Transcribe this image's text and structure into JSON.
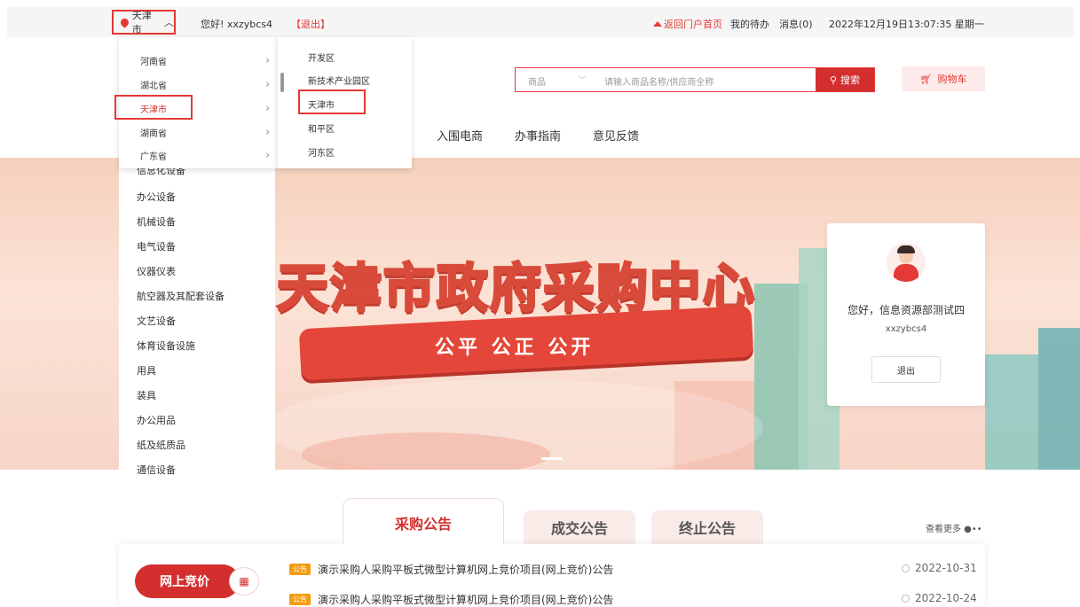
{
  "topbar": {
    "city": "天津市",
    "greeting": "您好! xxzybcs4",
    "logout_link": "【退出】",
    "home_link": "返回门户首页",
    "todo": "我的待办",
    "messages": "消息(0)",
    "datetime": "2022年12月19日13:07:35 星期一"
  },
  "region_dropdown": {
    "provinces": [
      "河南省",
      "湖北省",
      "天津市",
      "湖南省",
      "广东省"
    ],
    "selected_province": "天津市",
    "districts": [
      "开发区",
      "新技术产业园区",
      "天津市",
      "和平区",
      "河东区"
    ],
    "selected_district": "天津市"
  },
  "search": {
    "category": "商品",
    "placeholder": "请输入商品名称/供应商全称",
    "button": "搜索"
  },
  "cart": "购物车",
  "nav": [
    "入围电商",
    "办事指南",
    "意见反馈"
  ],
  "sidebar": {
    "categories": [
      "信息化设备",
      "办公设备",
      "机械设备",
      "电气设备",
      "仪器仪表",
      "航空器及其配套设备",
      "文艺设备",
      "体育设备设施",
      "用具",
      "装具",
      "办公用品",
      "纸及纸质品",
      "通信设备"
    ]
  },
  "banner": {
    "title": "天津市政府采购中心",
    "slogan": "公平 公正 公开"
  },
  "user_card": {
    "greeting": "您好，信息资源部测试四",
    "username": "xxzybcs4",
    "logout": "退出"
  },
  "tabs": [
    "采购公告",
    "成交公告",
    "终止公告"
  ],
  "active_tab": "采购公告",
  "more": "查看更多 ●••",
  "online_bid": "网上竞价",
  "notices": [
    {
      "badge": "公告",
      "title": "演示采购人采购平板式微型计算机网上竞价项目(网上竞价)公告",
      "date": "2022-10-31"
    },
    {
      "badge": "公告",
      "title": "演示采购人采购平板式微型计算机网上竞价项目(网上竞价)公告",
      "date": "2022-10-24"
    }
  ],
  "colors": {
    "accent": "#d32f2f",
    "highlight": "#e53935"
  }
}
